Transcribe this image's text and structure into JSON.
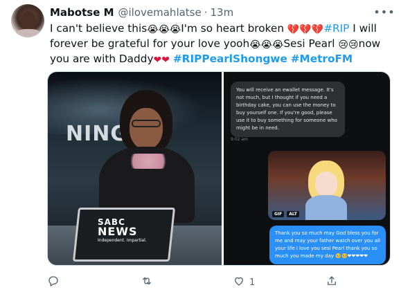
{
  "tweet": {
    "author_name": "Mabotse M",
    "author_handle": "@ilovemahlatse",
    "separator": "·",
    "timestamp": "13m",
    "text_parts": {
      "p1": "I can't believe this",
      "p2": "I'm so heart broken ",
      "rip_tag": "#RIP",
      "p3": " I will forever be grateful for your love yooh",
      "p4": "Sesi Pearl ",
      "p5": "now you are with Daddy",
      "hashtag1": "#RIPPearlShongwe",
      "hashtag2": "#MetroFM"
    },
    "emoji": {
      "crying": "😭",
      "broken_heart": "💔",
      "sad": "😢",
      "red_heart": "❤"
    }
  },
  "media": {
    "left_photo": {
      "screen_text": "NING",
      "desk_logo_line1": "SABC",
      "desk_logo_line2": "NEWS",
      "desk_logo_line3": "Independent. Impartial."
    },
    "chat": {
      "incoming_message": "You will receive an ewallet message. It's not much, but I thought if you need a birthday cake, you can use the money to buy yourself one. If you're good, please use it to buy something for someone who might be in need.",
      "incoming_time": "9:02 am",
      "gif_label": "GIF",
      "alt_label": "ALT",
      "outgoing_message": "Thank you so much may God bless you for me and may your father watch over you all your life i love you sesi Pearl thank you so much you made my day 🥺🥺❤❤❤❤❤"
    }
  },
  "actions": {
    "reply_count": "",
    "retweet_count": "",
    "like_count": "1",
    "share_count": ""
  },
  "colors": {
    "link_blue": "#1d9bf0",
    "text_primary": "#0f1419",
    "text_secondary": "#536471",
    "outgoing_bubble": "#2a8ff7"
  },
  "icons": {
    "more": "more-horizontal-icon",
    "reply": "reply-icon",
    "retweet": "retweet-icon",
    "like": "heart-icon",
    "share": "share-icon"
  }
}
